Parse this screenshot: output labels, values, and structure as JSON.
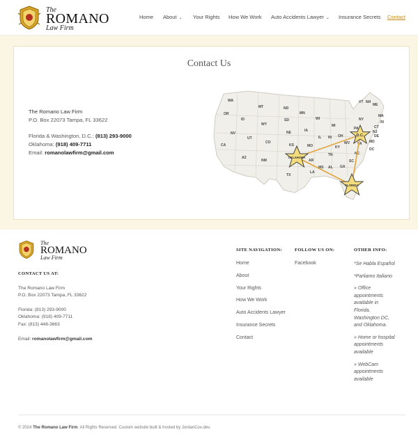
{
  "header": {
    "logo": {
      "the": "The",
      "name": "ROMANO",
      "firm": "Law Firm"
    },
    "nav": [
      {
        "label": "Home"
      },
      {
        "label": "About",
        "dropdown": true
      },
      {
        "label": "Your Rights"
      },
      {
        "label": "How We Work"
      },
      {
        "label": "Auto Accidents Lawyer",
        "dropdown": true
      },
      {
        "label": "Insurance Secrets"
      },
      {
        "label": "Contact",
        "active": true
      }
    ]
  },
  "main": {
    "title": "Contact Us",
    "contact": {
      "firm_name": "The Romano Law Firm",
      "address": "P.O. Box 22073 Tampa, FL 33622",
      "fl_dc_label": "Florida & Washington, D.C.:",
      "fl_dc_phone": "(813) 293-9000",
      "ok_label": "Oklahoma:",
      "ok_phone": "(918) 409-7711",
      "email_label": "Email:",
      "email": "romanolawfirm@gmail.com"
    },
    "map": {
      "states": [
        "WA",
        "MT",
        "ND",
        "MN",
        "OR",
        "ID",
        "WY",
        "SD",
        "WI",
        "MI",
        "NV",
        "UT",
        "CO",
        "NE",
        "IA",
        "IL",
        "IN",
        "OH",
        "PA",
        "NY",
        "CA",
        "AZ",
        "NM",
        "KS",
        "MO",
        "KY",
        "WV",
        "VA",
        "OK",
        "AR",
        "TN",
        "NC",
        "SC",
        "TX",
        "LA",
        "MS",
        "AL",
        "GA",
        "FL",
        "VT",
        "NH",
        "ME",
        "MA",
        "RI",
        "CT",
        "NJ",
        "DE",
        "MD",
        "DC"
      ],
      "markers": [
        "OKLAHOMA",
        "D.C.",
        "FLORIDA"
      ]
    }
  },
  "footer": {
    "logo": {
      "the": "The",
      "name": "ROMANO",
      "firm": "Law Firm"
    },
    "contact_heading": "CONTACT US AT:",
    "firm_name": "The Romano Law Firm",
    "address": "P.O. Box 22073 Tampa, FL 33622",
    "florida": "Florida: (813) 293-9000",
    "oklahoma": "Oklahoma: (918) 409-7711",
    "fax": "Fax: (813) 448-3663",
    "email_label": "Email:",
    "email": "romanolawfirm@gmail.com",
    "site_nav_heading": "SITE NAVIGATION:",
    "site_nav": [
      "Home",
      "About",
      "Your Rights",
      "How We Work",
      "Auto Accidents Lawyer",
      "Insurance Secrets",
      "Contact"
    ],
    "follow_heading": "FOLLOW US ON:",
    "follow": [
      "Facebook"
    ],
    "other_heading": "OTHER INFO:",
    "other": [
      "*Se Habla Español",
      "*Parliamo Italiano",
      "» Office appointments available in Florida, Washington DC, and Oklahoma.",
      "» Home or hospital appointments available",
      "» WebCam appointments available"
    ],
    "copyright_prefix": "© 2024",
    "copyright_firm": "The Romano Law Firm",
    "copyright_suffix": ". All Rights Reserved. Custom website built & hosted by JordanCox.dev."
  }
}
